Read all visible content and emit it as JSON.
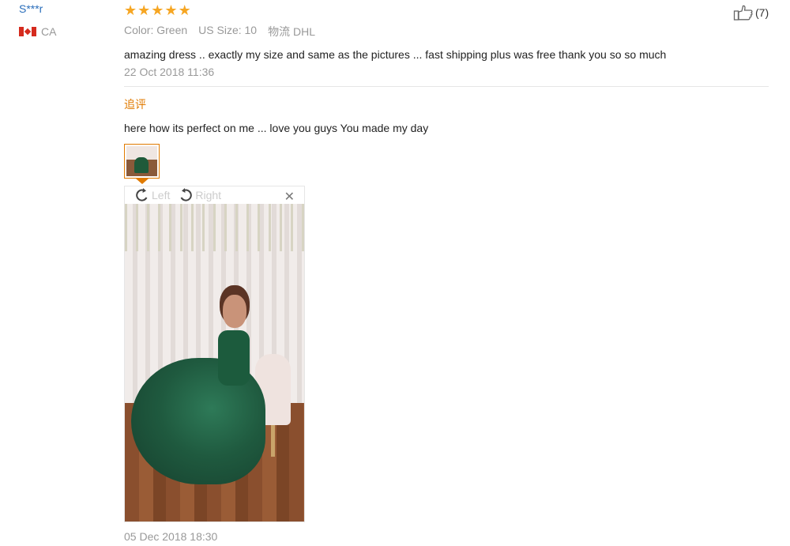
{
  "reviewer": {
    "name": "S***r",
    "country": "CA",
    "flag_icon": "canada-flag-icon"
  },
  "review": {
    "stars": 5,
    "star_color": "#f6a623",
    "color": "Color: Green",
    "size": "US Size: 10",
    "shipping": "物流 DHL",
    "text": "amazing dress .. exactly my size and same as the pictures ... fast shipping plus was free thank you so so much",
    "date": "22 Oct 2018 11:36"
  },
  "followup": {
    "label": "追评",
    "text": "here how its perfect on me ... love you guys You made my day",
    "date": "05 Dec 2018 18:30"
  },
  "viewer": {
    "rotate_left_label": "Left",
    "rotate_right_label": "Right",
    "close_icon": "close-icon",
    "close_glyph": "✕"
  },
  "likes": {
    "count": "(7)",
    "icon": "thumbs-up-icon"
  },
  "colors": {
    "username": "#2a6ebb",
    "followup_label": "#e07a00",
    "thumb_border": "#e07a00"
  }
}
